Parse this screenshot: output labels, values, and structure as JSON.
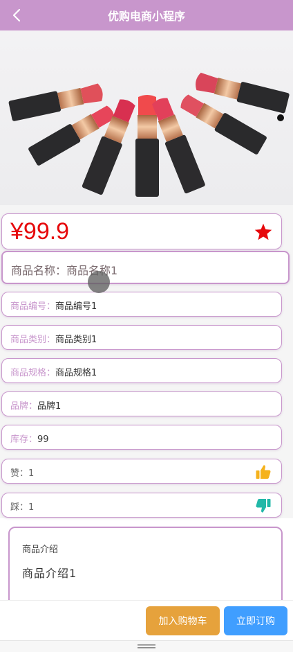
{
  "header": {
    "title": "优购电商小程序",
    "back_icon": "chevron-left-icon"
  },
  "product": {
    "price": "¥99.9",
    "name_label": "商品名称：",
    "name_value": "商品名称1",
    "fields": [
      {
        "label": "商品编号：",
        "value": "商品编号1"
      },
      {
        "label": "商品类别：",
        "value": "商品类别1"
      },
      {
        "label": "商品规格：",
        "value": "商品规格1"
      },
      {
        "label": "品牌：",
        "value": "品牌1"
      },
      {
        "label": "库存：",
        "value": "99"
      }
    ],
    "likes": {
      "label": "赞：",
      "value": "1",
      "icon": "thumbs-up-icon"
    },
    "dislikes": {
      "label": "踩：",
      "value": "1",
      "icon": "thumbs-down-icon"
    },
    "favorite_icon": "star-icon"
  },
  "description": {
    "title": "商品介绍",
    "text": "商品介绍1"
  },
  "actions": {
    "add_to_cart": "加入购物车",
    "buy_now": "立即订购"
  },
  "colors": {
    "header": "#c896cc",
    "price": "#e6080b",
    "cart_button": "#e6a23c",
    "buy_button": "#409eff",
    "thumbs_up": "#f5b21c",
    "thumbs_down": "#22b8a8"
  }
}
